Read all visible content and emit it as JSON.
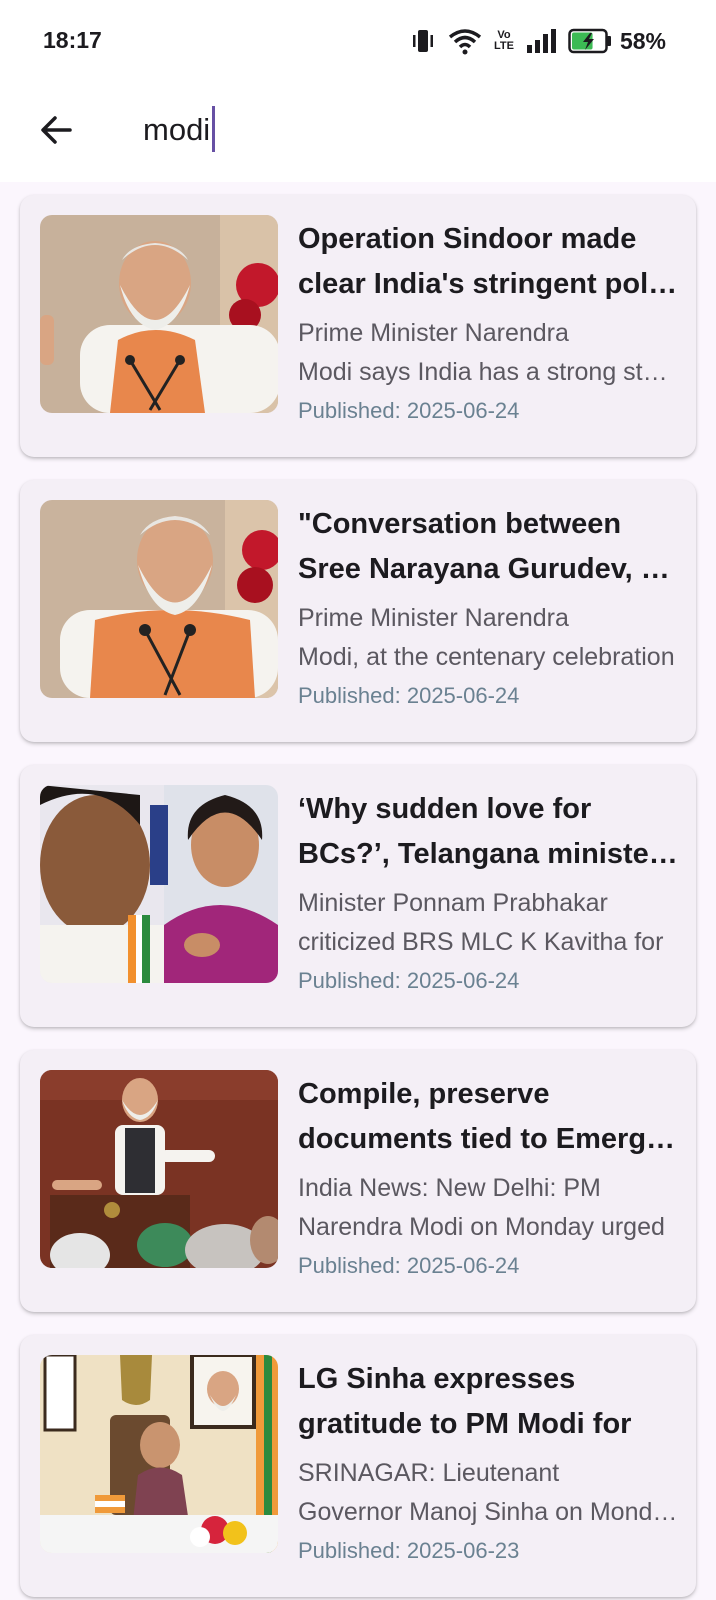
{
  "status_bar": {
    "time": "18:17",
    "volte_top": "Vo",
    "volte_bottom": "LTE",
    "battery_percent": "58%",
    "battery_level": 0.58,
    "icons": [
      "vibrate-icon",
      "wifi-icon",
      "volte-icon",
      "signal-icon",
      "battery-charging-icon"
    ]
  },
  "search": {
    "back_icon": "arrow-left-icon",
    "query": "modi"
  },
  "accent_color": "#6750a4",
  "date_color": "#6a8191",
  "results": [
    {
      "title_line1": "Operation Sindoor made",
      "title_line2": "clear India's stringent policy",
      "desc_line1": "Prime Minister Narendra",
      "desc_line2": "Modi says India has a strong stance",
      "date": "Published: 2025-06-24",
      "image": "pm-modi-speaking-photo"
    },
    {
      "title_line1": "\"Conversation between",
      "title_line2": "Sree Narayana Gurudev, Gandhi\"",
      "desc_line1": "Prime Minister Narendra",
      "desc_line2": "Modi, at the centenary celebration",
      "date": "Published: 2025-06-24",
      "image": "pm-modi-speaking-photo"
    },
    {
      "title_line1": "‘Why sudden love for",
      "title_line2": "BCs?’, Telangana minister asks",
      "desc_line1": "Minister Ponnam Prabhakar",
      "desc_line2": "criticized BRS MLC K Kavitha for",
      "date": "Published: 2025-06-24",
      "image": "two-politicians-photo"
    },
    {
      "title_line1": "Compile, preserve",
      "title_line2": "documents tied to Emergency",
      "desc_line1": "India News: New Delhi: PM",
      "desc_line2": "Narendra Modi on Monday urged",
      "date": "Published: 2025-06-24",
      "image": "pm-modi-podium-photo"
    },
    {
      "title_line1": "LG Sinha expresses",
      "title_line2": "gratitude to PM Modi for",
      "desc_line1": "SRINAGAR: Lieutenant",
      "desc_line2": "Governor Manoj Sinha on Monday",
      "date": "Published: 2025-06-23",
      "image": "lg-sinha-desk-photo"
    }
  ]
}
